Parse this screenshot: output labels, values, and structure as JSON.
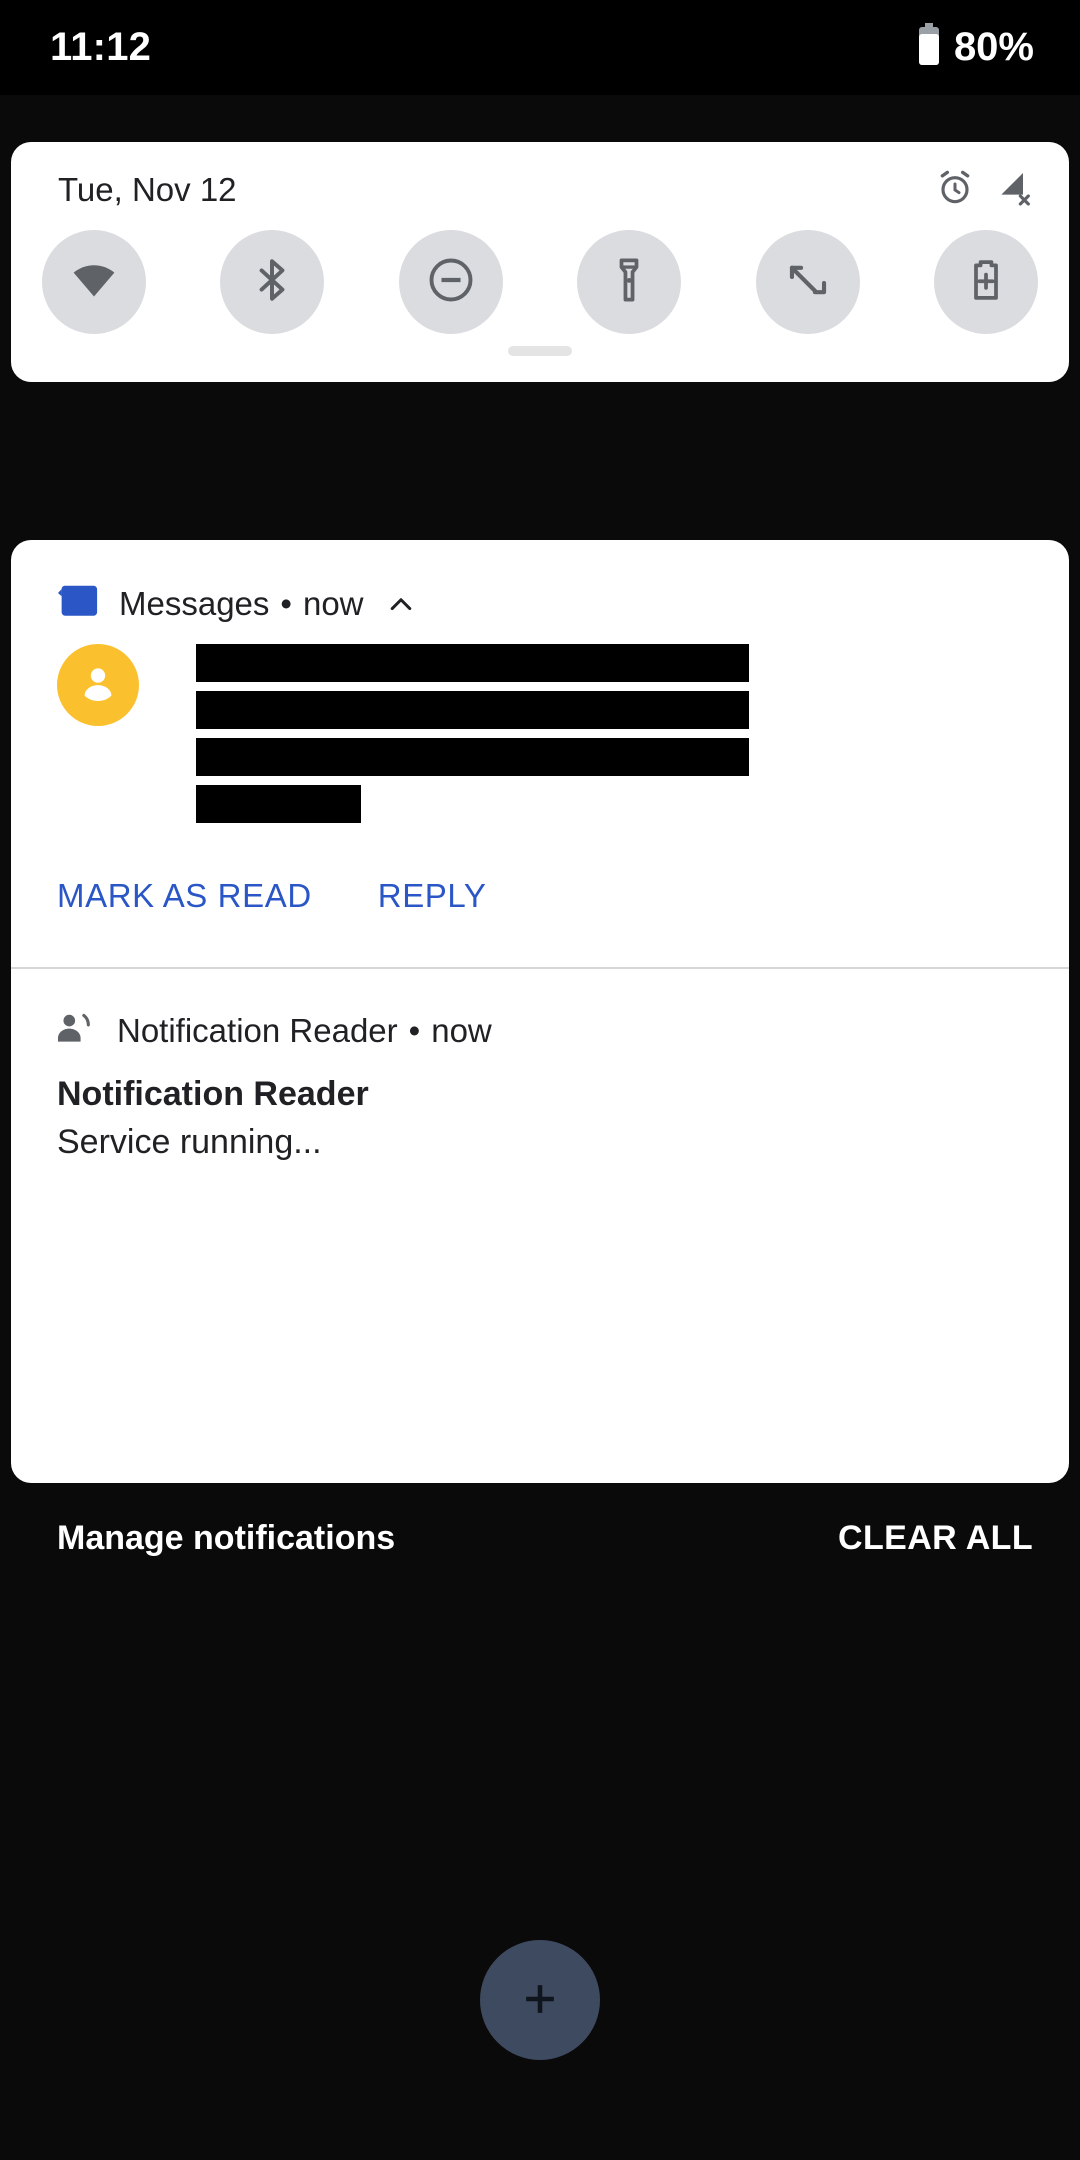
{
  "status_bar": {
    "clock": "11:12",
    "battery_percent": "80%",
    "battery_icon": "battery-icon"
  },
  "quick_settings": {
    "date": "Tue, Nov 12",
    "header_icons": [
      {
        "name": "alarm-clock-icon"
      },
      {
        "name": "signal-off-icon"
      }
    ],
    "tiles": [
      {
        "name": "wifi-tile",
        "icon": "wifi-icon"
      },
      {
        "name": "bluetooth-tile",
        "icon": "bluetooth-icon"
      },
      {
        "name": "do-not-disturb-tile",
        "icon": "do-not-disturb-icon"
      },
      {
        "name": "flashlight-tile",
        "icon": "flashlight-icon"
      },
      {
        "name": "auto-rotate-tile",
        "icon": "auto-rotate-icon"
      },
      {
        "name": "battery-saver-tile",
        "icon": "battery-saver-icon"
      }
    ],
    "drag_handle": "drag-handle"
  },
  "notifications": [
    {
      "app_name": "Messages",
      "separator": "•",
      "time": "now",
      "expand_icon": "chevron-up-icon",
      "avatar_icon": "person-avatar-icon",
      "avatar_color": "#fbc02d",
      "redacted_lines": [
        {
          "width": "full"
        },
        {
          "width": "full"
        },
        {
          "width": "full"
        },
        {
          "width": "short"
        }
      ],
      "actions": [
        {
          "label": "MARK AS READ",
          "name": "mark-as-read-button"
        },
        {
          "label": "REPLY",
          "name": "reply-button"
        }
      ],
      "action_color": "#2a56c6"
    },
    {
      "app_name": "Notification Reader",
      "separator": "•",
      "time": "now",
      "app_icon": "person-speaking-icon",
      "title": "Notification Reader",
      "text": "Service running..."
    }
  ],
  "footer": {
    "manage_label": "Manage notifications",
    "clear_all_label": "CLEAR ALL"
  },
  "fab": {
    "icon": "plus-icon",
    "color": "#3e4a5f"
  }
}
